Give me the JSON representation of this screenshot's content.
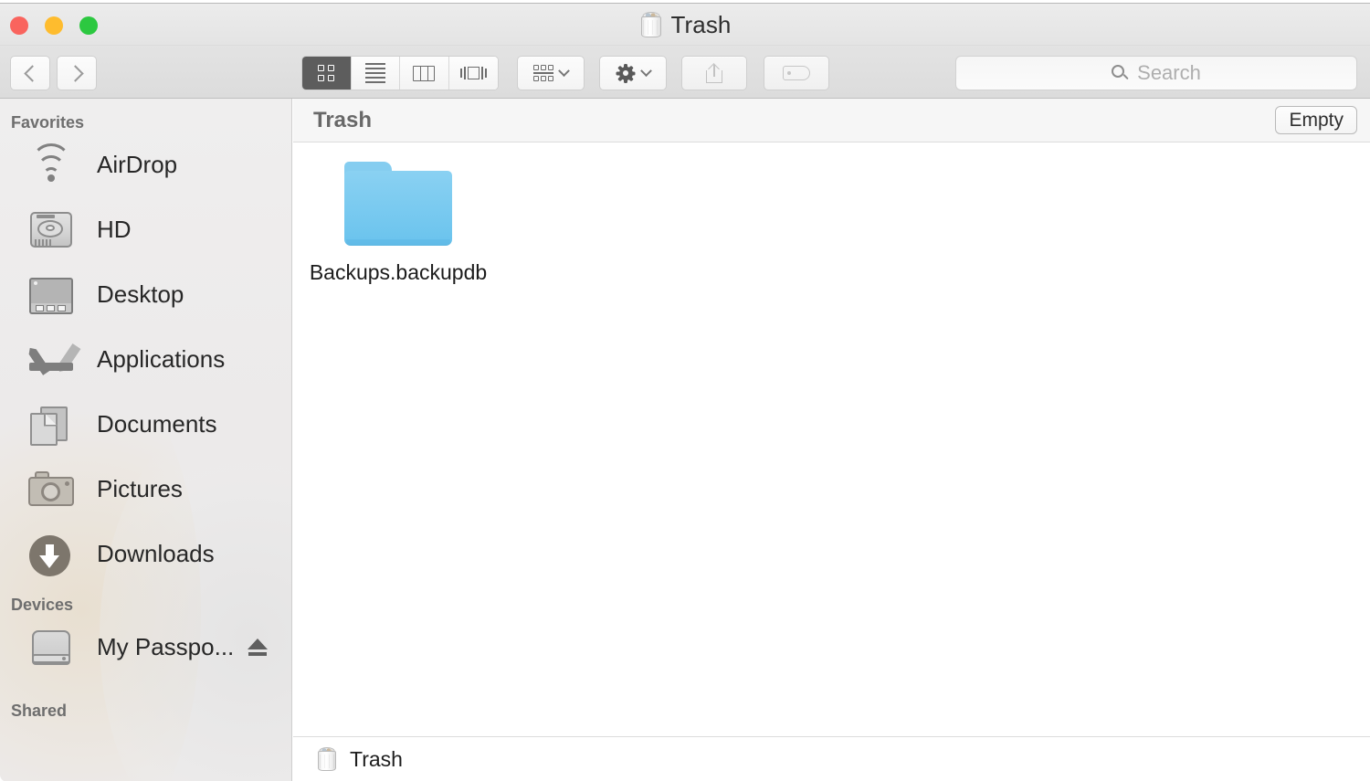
{
  "window": {
    "title": "Trash",
    "title_icon": "trash-icon",
    "traffic_lights": {
      "close": "#f9645e",
      "minimize": "#febc2e",
      "maximize": "#2cc840"
    }
  },
  "toolbar": {
    "back_icon": "chevron-left-icon",
    "forward_icon": "chevron-right-icon",
    "view_modes": [
      {
        "id": "icon-view",
        "icon": "grid-view-icon",
        "active": true
      },
      {
        "id": "list-view",
        "icon": "list-view-icon",
        "active": false
      },
      {
        "id": "column-view",
        "icon": "column-view-icon",
        "active": false
      },
      {
        "id": "gallery-view",
        "icon": "gallery-view-icon",
        "active": false
      }
    ],
    "arrange_icon": "arrange-icon",
    "action_icon": "gear-icon",
    "share_icon": "share-icon",
    "tag_icon": "tag-icon",
    "dropdown_icon": "chevron-down-icon"
  },
  "search": {
    "icon": "search-icon",
    "placeholder": "Search",
    "value": ""
  },
  "sidebar": {
    "sections": [
      {
        "label": "Favorites",
        "items": [
          {
            "label": "AirDrop",
            "icon": "airdrop-icon"
          },
          {
            "label": "HD",
            "icon": "hard-drive-icon"
          },
          {
            "label": "Desktop",
            "icon": "desktop-icon"
          },
          {
            "label": "Applications",
            "icon": "applications-icon"
          },
          {
            "label": "Documents",
            "icon": "documents-icon"
          },
          {
            "label": "Pictures",
            "icon": "pictures-icon"
          },
          {
            "label": "Downloads",
            "icon": "downloads-icon"
          }
        ]
      },
      {
        "label": "Devices",
        "items": [
          {
            "label": "My Passpo...",
            "icon": "external-drive-icon",
            "eject": "eject-icon"
          }
        ]
      },
      {
        "label": "Shared",
        "items": []
      }
    ]
  },
  "content": {
    "header_title": "Trash",
    "empty_button_label": "Empty",
    "files": [
      {
        "name": "Backups.backupdb",
        "icon": "folder-icon",
        "color": "#6cc4ee"
      }
    ]
  },
  "status_bar": {
    "icon": "trash-icon",
    "label": "Trash"
  }
}
